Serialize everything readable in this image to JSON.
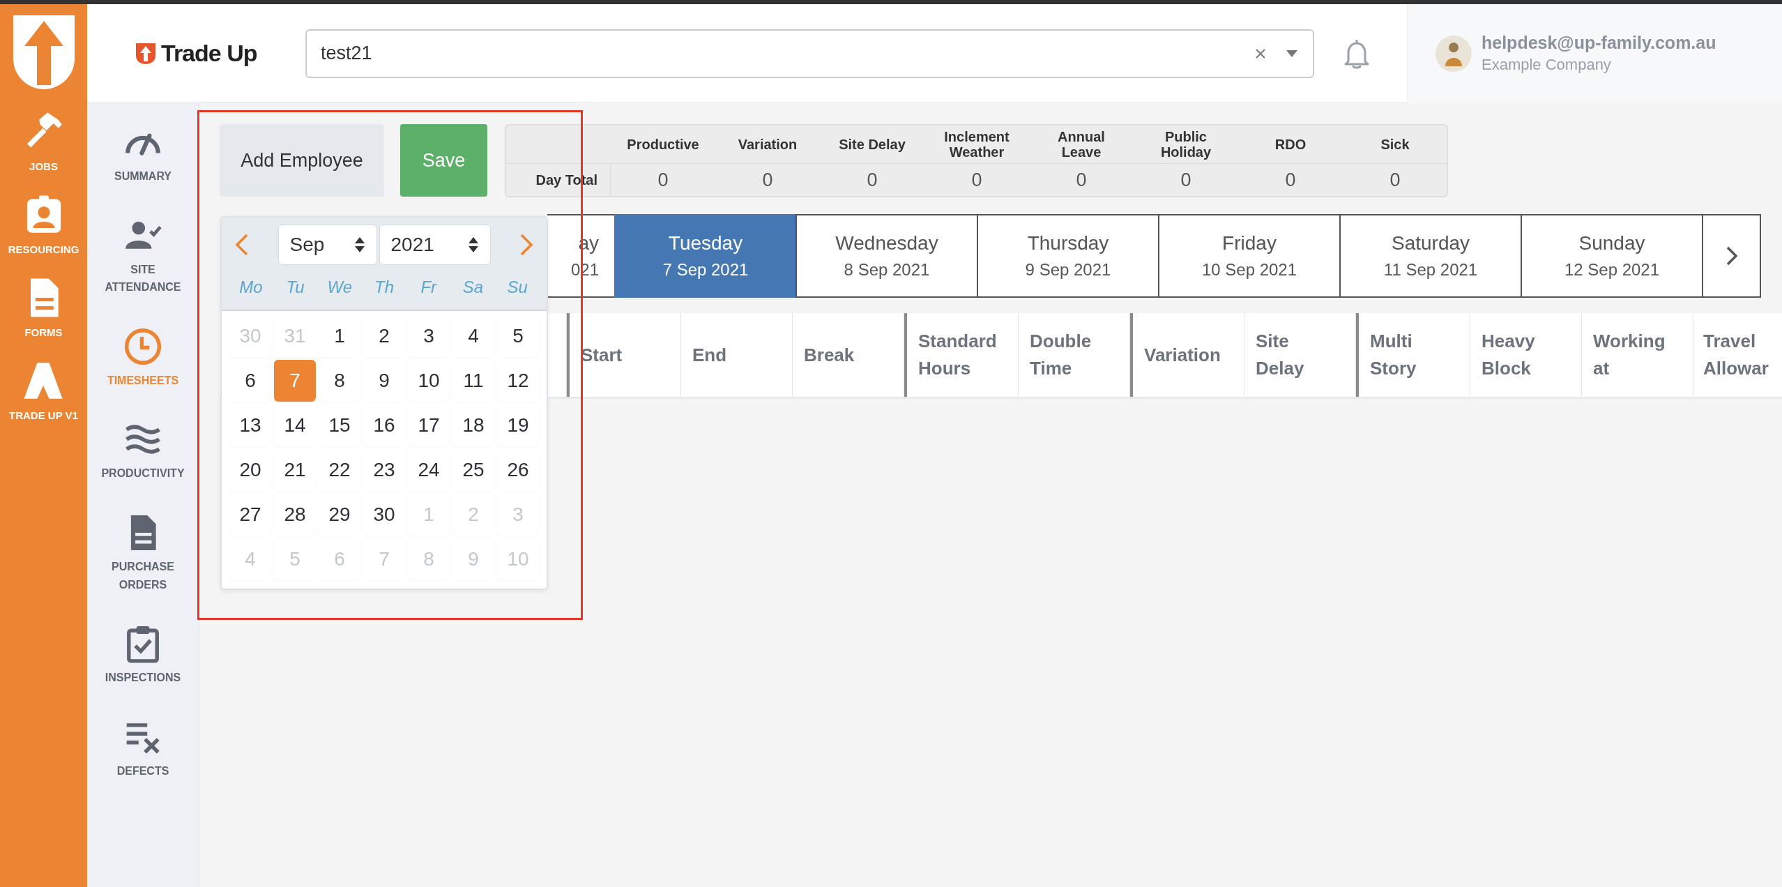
{
  "rail": {
    "items": [
      {
        "label": "JOBS"
      },
      {
        "label": "RESOURCING"
      },
      {
        "label": "FORMS"
      },
      {
        "label": "TRADE UP V1"
      }
    ]
  },
  "subnav": {
    "items": [
      {
        "label": "SUMMARY",
        "selected": false
      },
      {
        "label": "SITE ATTENDANCE",
        "selected": false
      },
      {
        "label": "TIMESHEETS",
        "selected": true
      },
      {
        "label": "PRODUCTIVITY",
        "selected": false
      },
      {
        "label": "PURCHASE ORDERS",
        "selected": false
      },
      {
        "label": "INSPECTIONS",
        "selected": false
      },
      {
        "label": "DEFECTS",
        "selected": false
      }
    ]
  },
  "header": {
    "brand": "Trade Up",
    "search": {
      "value": "test21"
    },
    "user": {
      "email": "helpdesk@up-family.com.au",
      "company": "Example Company"
    }
  },
  "toolbar": {
    "buttons": [
      {
        "label": "Add Employee",
        "kind": "secondary"
      },
      {
        "label": "Save",
        "kind": "primary"
      }
    ]
  },
  "day_totals": {
    "row_label": "Day Total",
    "columns": [
      {
        "label": "Productive",
        "value": "0"
      },
      {
        "label": "Variation",
        "value": "0"
      },
      {
        "label": "Site Delay",
        "value": "0"
      },
      {
        "label": "Inclement Weather",
        "value": "0"
      },
      {
        "label": "Annual Leave",
        "value": "0"
      },
      {
        "label": "Public Holiday",
        "value": "0"
      },
      {
        "label": "RDO",
        "value": "0"
      },
      {
        "label": "Sick",
        "value": "0"
      }
    ]
  },
  "days": [
    {
      "day": "ay",
      "date": "021",
      "kind": "cut",
      "selected": false
    },
    {
      "day": "Tuesday",
      "date": "7 Sep 2021",
      "kind": "full",
      "selected": true
    },
    {
      "day": "Wednesday",
      "date": "8 Sep 2021",
      "kind": "full",
      "selected": false
    },
    {
      "day": "Thursday",
      "date": "9 Sep 2021",
      "kind": "full",
      "selected": false
    },
    {
      "day": "Friday",
      "date": "10 Sep 2021",
      "kind": "full",
      "selected": false
    },
    {
      "day": "Saturday",
      "date": "11 Sep 2021",
      "kind": "full",
      "selected": false
    },
    {
      "day": "Sunday",
      "date": "12 Sep 2021",
      "kind": "full",
      "selected": false
    }
  ],
  "table": {
    "column_groups": [
      {
        "columns": [
          "Start",
          "End",
          "Break"
        ]
      },
      {
        "columns": [
          "Standard Hours",
          "Double Time"
        ]
      },
      {
        "columns": [
          "Variation",
          "Site Delay"
        ]
      },
      {
        "columns": [
          "Multi Story",
          "Heavy Block",
          "Working at",
          "Travel Allowar"
        ]
      }
    ]
  },
  "calendar": {
    "month": "Sep",
    "year": "2021",
    "weekdays": [
      "Mo",
      "Tu",
      "We",
      "Th",
      "Fr",
      "Sa",
      "Su"
    ],
    "weeks": [
      [
        {
          "day": "30",
          "outside": true,
          "selected": false
        },
        {
          "day": "31",
          "outside": true,
          "selected": false
        },
        {
          "day": "1",
          "outside": false,
          "selected": false
        },
        {
          "day": "2",
          "outside": false,
          "selected": false
        },
        {
          "day": "3",
          "outside": false,
          "selected": false
        },
        {
          "day": "4",
          "outside": false,
          "selected": false
        },
        {
          "day": "5",
          "outside": false,
          "selected": false
        }
      ],
      [
        {
          "day": "6",
          "outside": false,
          "selected": false
        },
        {
          "day": "7",
          "outside": false,
          "selected": true
        },
        {
          "day": "8",
          "outside": false,
          "selected": false
        },
        {
          "day": "9",
          "outside": false,
          "selected": false
        },
        {
          "day": "10",
          "outside": false,
          "selected": false
        },
        {
          "day": "11",
          "outside": false,
          "selected": false
        },
        {
          "day": "12",
          "outside": false,
          "selected": false
        }
      ],
      [
        {
          "day": "13",
          "outside": false,
          "selected": false
        },
        {
          "day": "14",
          "outside": false,
          "selected": false
        },
        {
          "day": "15",
          "outside": false,
          "selected": false
        },
        {
          "day": "16",
          "outside": false,
          "selected": false
        },
        {
          "day": "17",
          "outside": false,
          "selected": false
        },
        {
          "day": "18",
          "outside": false,
          "selected": false
        },
        {
          "day": "19",
          "outside": false,
          "selected": false
        }
      ],
      [
        {
          "day": "20",
          "outside": false,
          "selected": false
        },
        {
          "day": "21",
          "outside": false,
          "selected": false
        },
        {
          "day": "22",
          "outside": false,
          "selected": false
        },
        {
          "day": "23",
          "outside": false,
          "selected": false
        },
        {
          "day": "24",
          "outside": false,
          "selected": false
        },
        {
          "day": "25",
          "outside": false,
          "selected": false
        },
        {
          "day": "26",
          "outside": false,
          "selected": false
        }
      ],
      [
        {
          "day": "27",
          "outside": false,
          "selected": false
        },
        {
          "day": "28",
          "outside": false,
          "selected": false
        },
        {
          "day": "29",
          "outside": false,
          "selected": false
        },
        {
          "day": "30",
          "outside": false,
          "selected": false
        },
        {
          "day": "1",
          "outside": true,
          "selected": false
        },
        {
          "day": "2",
          "outside": true,
          "selected": false
        },
        {
          "day": "3",
          "outside": true,
          "selected": false
        }
      ],
      [
        {
          "day": "4",
          "outside": true,
          "selected": false
        },
        {
          "day": "5",
          "outside": true,
          "selected": false
        },
        {
          "day": "6",
          "outside": true,
          "selected": false
        },
        {
          "day": "7",
          "outside": true,
          "selected": false
        },
        {
          "day": "8",
          "outside": true,
          "selected": false
        },
        {
          "day": "9",
          "outside": true,
          "selected": false
        },
        {
          "day": "10",
          "outside": true,
          "selected": false
        }
      ]
    ]
  }
}
